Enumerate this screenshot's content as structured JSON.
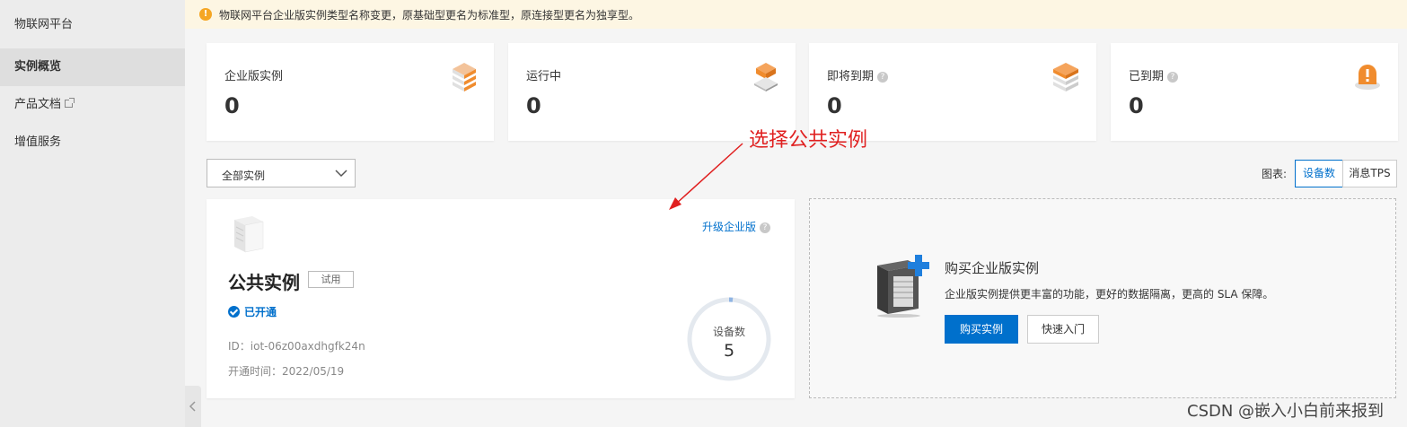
{
  "sidebar": {
    "title": "物联网平台",
    "items": [
      {
        "label": "实例概览"
      },
      {
        "label": "产品文档"
      },
      {
        "label": "增值服务"
      }
    ]
  },
  "notice": {
    "text": "物联网平台企业版实例类型名称变更，原基础型更名为标准型，原连接型更名为独享型。"
  },
  "stats": [
    {
      "label": "企业版实例",
      "value": "0"
    },
    {
      "label": "运行中",
      "value": "0"
    },
    {
      "label": "即将到期",
      "value": "0"
    },
    {
      "label": "已到期",
      "value": "0"
    }
  ],
  "filter": {
    "selected": "全部实例",
    "chart_label": "图表:",
    "chart_options": [
      "设备数",
      "消息TPS"
    ],
    "active_option": "设备数"
  },
  "public_instance": {
    "title": "公共实例",
    "badge": "试用",
    "status": "已开通",
    "id_text": "ID：iot-06z00axdhgfk24n",
    "open_time": "开通时间：2022/05/19",
    "upgrade_link": "升级企业版",
    "metric_label": "设备数",
    "metric_value": "5"
  },
  "purchase": {
    "title": "购买企业版实例",
    "description": "企业版实例提供更丰富的功能，更好的数据隔离，更高的 SLA 保障。",
    "buy_button": "购买实例",
    "quickstart_button": "快速入门"
  },
  "annotation": {
    "text": "选择公共实例"
  },
  "watermark": "CSDN @嵌入小白前来报到",
  "colors": {
    "accent": "#0070cc",
    "annotation": "#e02020",
    "orange": "#f08c2e",
    "notice_bg": "#fdf6e3"
  }
}
